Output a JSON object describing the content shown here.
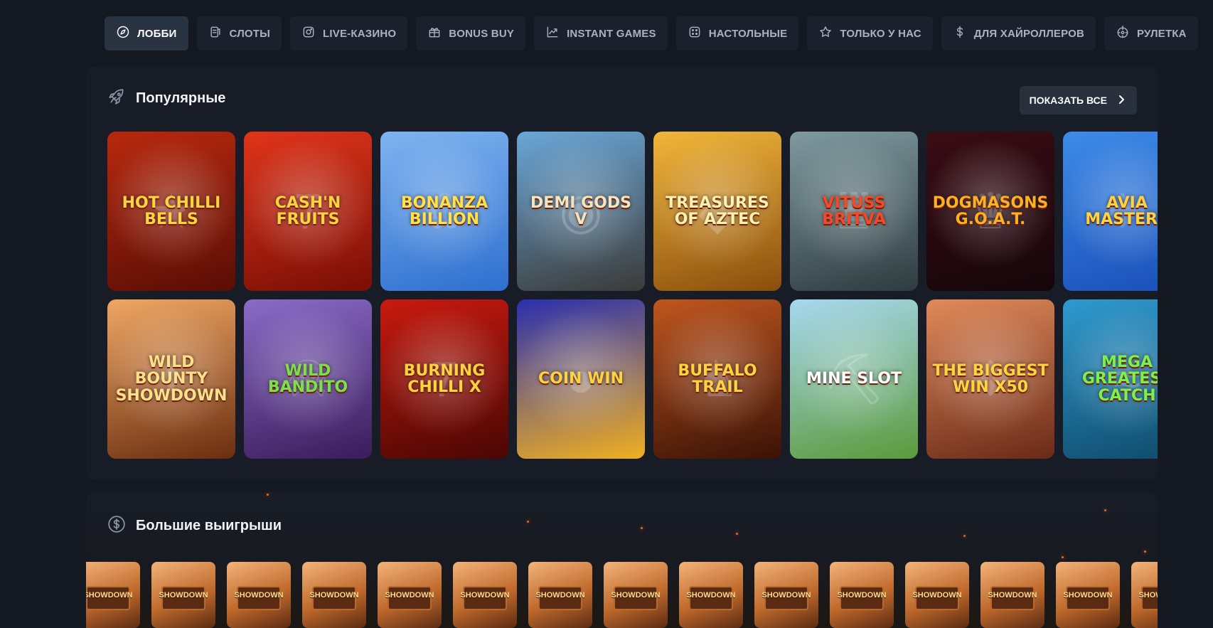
{
  "nav": {
    "items": [
      {
        "label": "ЛОББИ",
        "icon": "compass-icon",
        "active": true
      },
      {
        "label": "СЛОТЫ",
        "icon": "slot-machine-icon"
      },
      {
        "label": "LIVE-КАЗИНО",
        "icon": "live-camera-icon"
      },
      {
        "label": "BONUS BUY",
        "icon": "gift-icon"
      },
      {
        "label": "INSTANT GAMES",
        "icon": "chart-arrow-icon"
      },
      {
        "label": "НАСТОЛЬНЫЕ",
        "icon": "dice-icon"
      },
      {
        "label": "ТОЛЬКО У НАС",
        "icon": "star-icon"
      },
      {
        "label": "ДЛЯ ХАЙРОЛЛЕРОВ",
        "icon": "dollar-icon"
      },
      {
        "label": "РУЛЕТКА",
        "icon": "roulette-icon"
      }
    ]
  },
  "popular": {
    "title": "Популярные",
    "icon": "rocket-icon",
    "show_all_label": "ПОКАЗАТЬ ВСЕ",
    "games": [
      {
        "name": "Hot Chilli Bells",
        "bg": "#b8290e",
        "bg2": "#5a0d05",
        "art": "★",
        "color": "#ffd23f"
      },
      {
        "name": "Cash'n Fruits",
        "bg": "#e0351a",
        "bg2": "#7a0e06",
        "art": "7",
        "color": "#ffd23f"
      },
      {
        "name": "Bonanza Billion",
        "bg": "#7fb4f0",
        "bg2": "#2e6fcf",
        "art": "✿",
        "color": "#ffe14a"
      },
      {
        "name": "Demi Gods V",
        "bg": "#6aa7d8",
        "bg2": "#3b3a38",
        "art": "◉",
        "color": "#f2e6c2"
      },
      {
        "name": "Treasures of Aztec",
        "bg": "#f2b63a",
        "bg2": "#8a4e0d",
        "art": "◆",
        "color": "#fff2b0"
      },
      {
        "name": "Vituss Britva",
        "bg": "#7f9aa0",
        "bg2": "#2f3b3f",
        "art": "♜",
        "color": "#f24a2a"
      },
      {
        "name": "Dogmasons G.O.A.T.",
        "bg": "#3a0c14",
        "bg2": "#14060a",
        "art": "♛",
        "color": "#ffb020"
      },
      {
        "name": "Avia Masters",
        "bg": "#3d8be8",
        "bg2": "#1a4fb8",
        "art": "✈",
        "color": "#ffd23f"
      },
      {
        "name": "Wild Bounty Showdown",
        "bg": "#f0a764",
        "bg2": "#6a2e10",
        "art": "✦",
        "color": "#ffe08a"
      },
      {
        "name": "Wild Bandito",
        "bg": "#8a6bc8",
        "bg2": "#3a1c5a",
        "art": "☠",
        "color": "#7be04a"
      },
      {
        "name": "Burning Chilli X",
        "bg": "#c81a0e",
        "bg2": "#4a0604",
        "art": "7",
        "color": "#ffd23f"
      },
      {
        "name": "Coin Win",
        "bg": "#2a2fb0",
        "bg2": "#f0b020",
        "art": "●",
        "color": "#ffd23f"
      },
      {
        "name": "Buffalo Trail",
        "bg": "#c0561e",
        "bg2": "#3a1206",
        "art": "♞",
        "color": "#ffd23f"
      },
      {
        "name": "Mine Slot",
        "bg": "#a8d8f0",
        "bg2": "#5b9a3a",
        "art": "⛏",
        "color": "#ffffff"
      },
      {
        "name": "The Biggest Win X50",
        "bg": "#e08a5a",
        "bg2": "#6a2a18",
        "art": "❖",
        "color": "#ffd23f"
      },
      {
        "name": "Mega Greatest Catch",
        "bg": "#2f9ad0",
        "bg2": "#0f4a6a",
        "art": "≈",
        "color": "#7df04a"
      }
    ]
  },
  "big_wins": {
    "title": "Большие выигрыши",
    "icon": "dollar-circle-icon",
    "tile_label": "SHOWDOWN",
    "tiles": 15
  }
}
